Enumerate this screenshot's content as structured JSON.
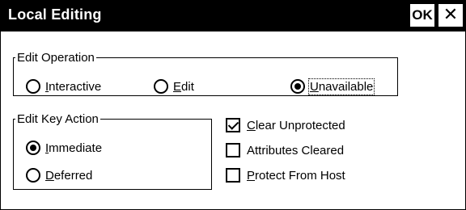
{
  "window": {
    "title": "Local Editing",
    "ok_label": "OK",
    "close_label": "✕"
  },
  "edit_operation": {
    "legend": "Edit Operation",
    "options": [
      {
        "label": "Interactive",
        "selected": false
      },
      {
        "label": "Edit",
        "selected": false
      },
      {
        "label": "Unavailable",
        "selected": true
      }
    ]
  },
  "edit_key_action": {
    "legend": "Edit Key Action",
    "options": [
      {
        "label": "Immediate",
        "selected": true
      },
      {
        "label": "Deferred",
        "selected": false
      }
    ]
  },
  "checkboxes": [
    {
      "label": "Clear Unprotected",
      "checked": true
    },
    {
      "label": "Attributes Cleared",
      "checked": false
    },
    {
      "label": "Protect From Host",
      "checked": false
    }
  ]
}
